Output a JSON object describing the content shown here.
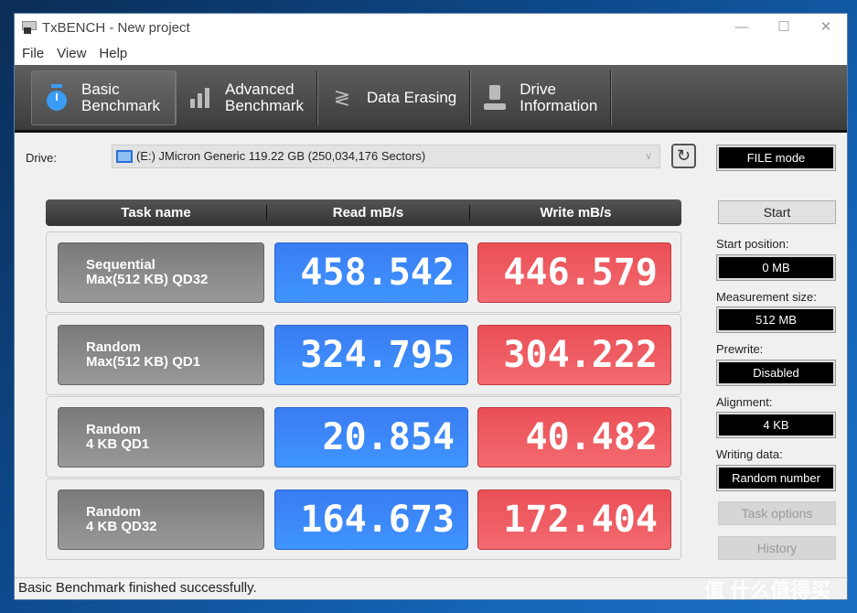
{
  "window": {
    "title": "TxBENCH - New project",
    "minimize": "—",
    "maximize": "☐",
    "close": "✕"
  },
  "menu": [
    "File",
    "View",
    "Help"
  ],
  "tabs": [
    {
      "line1": "Basic",
      "line2": "Benchmark",
      "icon": "stopwatch-icon",
      "active": true
    },
    {
      "line1": "Advanced",
      "line2": "Benchmark",
      "icon": "bar-chart-icon",
      "active": false
    },
    {
      "line1": "Data Erasing",
      "line2": "",
      "icon": "eraser-icon",
      "active": false
    },
    {
      "line1": "Drive",
      "line2": "Information",
      "icon": "drive-info-icon",
      "active": false
    }
  ],
  "drive": {
    "label": "Drive:",
    "selected": "(E:) JMicron Generic  119.22 GB (250,034,176 Sectors)"
  },
  "table": {
    "headers": [
      "Task name",
      "Read mB/s",
      "Write mB/s"
    ],
    "rows": [
      {
        "name1": "Sequential",
        "name2": "Max(512 KB) QD32",
        "read": "458.542",
        "write": "446.579"
      },
      {
        "name1": "Random",
        "name2": "Max(512 KB) QD1",
        "read": "324.795",
        "write": "304.222"
      },
      {
        "name1": "Random",
        "name2": "4 KB QD1",
        "read": "20.854",
        "write": "40.482"
      },
      {
        "name1": "Random",
        "name2": "4 KB QD32",
        "read": "164.673",
        "write": "172.404"
      }
    ]
  },
  "side": {
    "mode": "FILE mode",
    "start": "Start",
    "start_position_label": "Start position:",
    "start_position": "0 MB",
    "measurement_size_label": "Measurement size:",
    "measurement_size": "512 MB",
    "prewrite_label": "Prewrite:",
    "prewrite": "Disabled",
    "alignment_label": "Alignment:",
    "alignment": "4 KB",
    "writing_data_label": "Writing data:",
    "writing_data": "Random number",
    "task_options": "Task options",
    "history": "History"
  },
  "status": "Basic Benchmark finished successfully.",
  "watermark": "值 什么值得买",
  "colors": {
    "read": "#3f8cff",
    "write": "#ee5a60",
    "toolbar": "#4a4a4a"
  }
}
